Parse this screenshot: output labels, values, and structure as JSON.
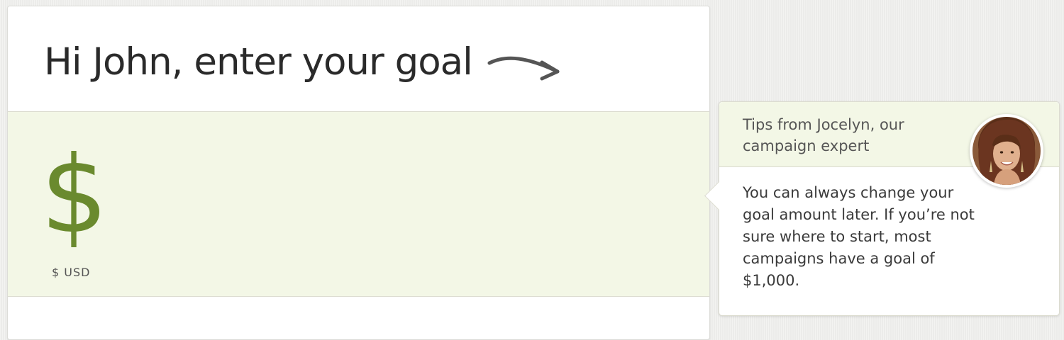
{
  "header": {
    "title": "Hi John, enter your goal"
  },
  "goal": {
    "currency_symbol": "$",
    "currency_label": "$ USD",
    "value": ""
  },
  "tip": {
    "title": "Tips from Jocelyn, our campaign expert",
    "body": "You can always change your goal amount later. If you’re not sure where to start, most campaigns have a goal of $1,000."
  },
  "colors": {
    "accent_green": "#6a8a2e",
    "panel_tint": "#f3f7e6"
  },
  "icons": {
    "arrow": "curved-arrow-icon"
  }
}
